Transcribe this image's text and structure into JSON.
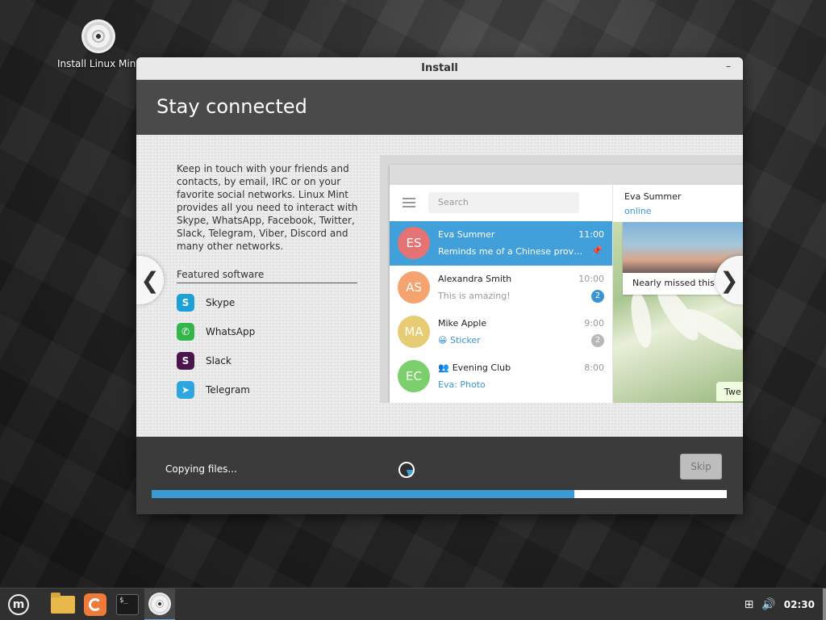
{
  "desktop": {
    "icon_label": "Install Linux Mint"
  },
  "window": {
    "title": "Install",
    "minimize_glyph": "–",
    "header_title": "Stay connected",
    "description": "Keep in touch with your friends and contacts, by email, IRC or on your favorite social networks. Linux Mint provides all you need to interact with Skype, WhatsApp, Facebook, Twitter, Slack, Telegram, Viber, Discord and many other networks.",
    "featured_title": "Featured software",
    "apps": [
      {
        "name": "Skype",
        "glyph": "S",
        "color": "#1ba0d8",
        "icon": "skype-icon"
      },
      {
        "name": "WhatsApp",
        "glyph": "✆",
        "color": "#34b54a",
        "icon": "whatsapp-icon"
      },
      {
        "name": "Slack",
        "glyph": "S",
        "color": "#4a154b",
        "icon": "slack-icon"
      },
      {
        "name": "Telegram",
        "glyph": "➤",
        "color": "#2ea6df",
        "icon": "telegram-icon"
      }
    ],
    "nav_prev": "❮",
    "nav_next": "❯"
  },
  "telegram": {
    "search_placeholder": "Search",
    "chats": [
      {
        "initials": "ES",
        "name": "Eva Summer",
        "time": "11:00",
        "message": "Reminds me of a Chinese prover...",
        "avatar_color": "#e57373",
        "badge": "",
        "active": true
      },
      {
        "initials": "AS",
        "name": "Alexandra Smith",
        "time": "10:00",
        "message": "This is amazing!",
        "avatar_color": "#f5a36f",
        "badge": "2",
        "badge_color": "#3a96d3"
      },
      {
        "initials": "MA",
        "name": "Mike Apple",
        "time": "9:00",
        "message": "😀 Sticker",
        "avatar_color": "#e8cc74",
        "badge": "2",
        "badge_color": "#b8b8b8"
      },
      {
        "initials": "EC",
        "name": "Evening Club",
        "time": "8:00",
        "message": "Eva: Photo",
        "avatar_color": "#7bcf6c",
        "badge": ""
      }
    ],
    "open_chat_name": "Eva Summer",
    "open_chat_status": "online",
    "photo_caption": "Nearly missed this s",
    "bubble_text": "Twe"
  },
  "footer": {
    "status": "Copying files...",
    "skip_label": "Skip",
    "progress": 0.735
  },
  "taskbar": {
    "clock": "02:30",
    "terminal_text": "$_"
  },
  "colors": {
    "accent": "#3a9ad6",
    "header_bg": "#4a4a4a",
    "telegram_active": "#419fd9"
  }
}
